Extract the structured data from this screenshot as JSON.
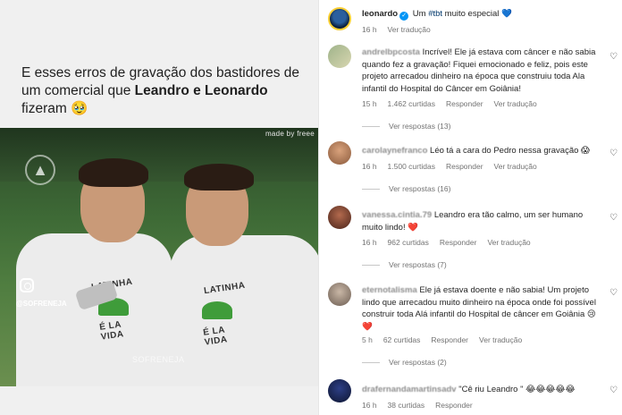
{
  "post": {
    "caption_before": "E esses erros de gravação dos bastidores de um comercial que ",
    "caption_bold": "Leandro e Leonardo",
    "caption_after": " fizeram 🥹",
    "video_watermark": "made by freee",
    "video_handle": "@SOFRENEJA",
    "video_bottom_watermark": "SOFRENEJA",
    "shirt_text_1": "LATINHA",
    "shirt_text_2": "É LA VIDA",
    "shirt_text_3": "LATINHA",
    "shirt_text_4": "É LA VIDA"
  },
  "owner": {
    "username": "leonardo",
    "text_before": "Um ",
    "hashtag": "#tbt",
    "text_after": " muito especial 💙",
    "time": "16 h",
    "translate": "Ver tradução"
  },
  "comments": [
    {
      "username": "andrelbpcosta",
      "text": "Incrível! Ele já estava com câncer e não sabia quando fez a gravação! Fiquei emocionado e feliz, pois este projeto arrecadou dinheiro na época que construiu toda Ala infantil do Hospital do Câncer em Goiânia!",
      "time": "15 h",
      "likes": "1.462 curtidas",
      "reply": "Responder",
      "translate": "Ver tradução",
      "replies": "Ver respostas (13)"
    },
    {
      "username": "carolaynefranco",
      "text": "Léo tá a cara do Pedro nessa gravação 😱",
      "time": "16 h",
      "likes": "1.500 curtidas",
      "reply": "Responder",
      "translate": "Ver tradução",
      "replies": "Ver respostas (16)"
    },
    {
      "username": "vanessa.cintia.79",
      "text": "Leandro era tão calmo, um ser humano muito lindo! ❤️",
      "time": "16 h",
      "likes": "962 curtidas",
      "reply": "Responder",
      "translate": "Ver tradução",
      "replies": "Ver respostas (7)"
    },
    {
      "username": "eternotalisma",
      "text": "Ele já estava doente e não sabia! Um projeto lindo que arrecadou muito dinheiro na época onde foi possível construir toda Alá infantil do Hospital de câncer em Goiânia 😢❤️",
      "time": "5 h",
      "likes": "62 curtidas",
      "reply": "Responder",
      "translate": "Ver tradução",
      "replies": "Ver respostas (2)"
    },
    {
      "username": "drafernandamartinsadv",
      "text": "\"Cê riu Leandro \" 😂😂😂😂😂",
      "time": "16 h",
      "likes": "38 curtidas",
      "reply": "Responder",
      "translate": "",
      "replies": ""
    }
  ],
  "colors": {
    "verified": "#0095f6",
    "meta_gray": "#737373",
    "hashtag": "#00376b"
  },
  "icons": {
    "like": "heart-outline-icon",
    "verified": "verified-badge-icon"
  }
}
